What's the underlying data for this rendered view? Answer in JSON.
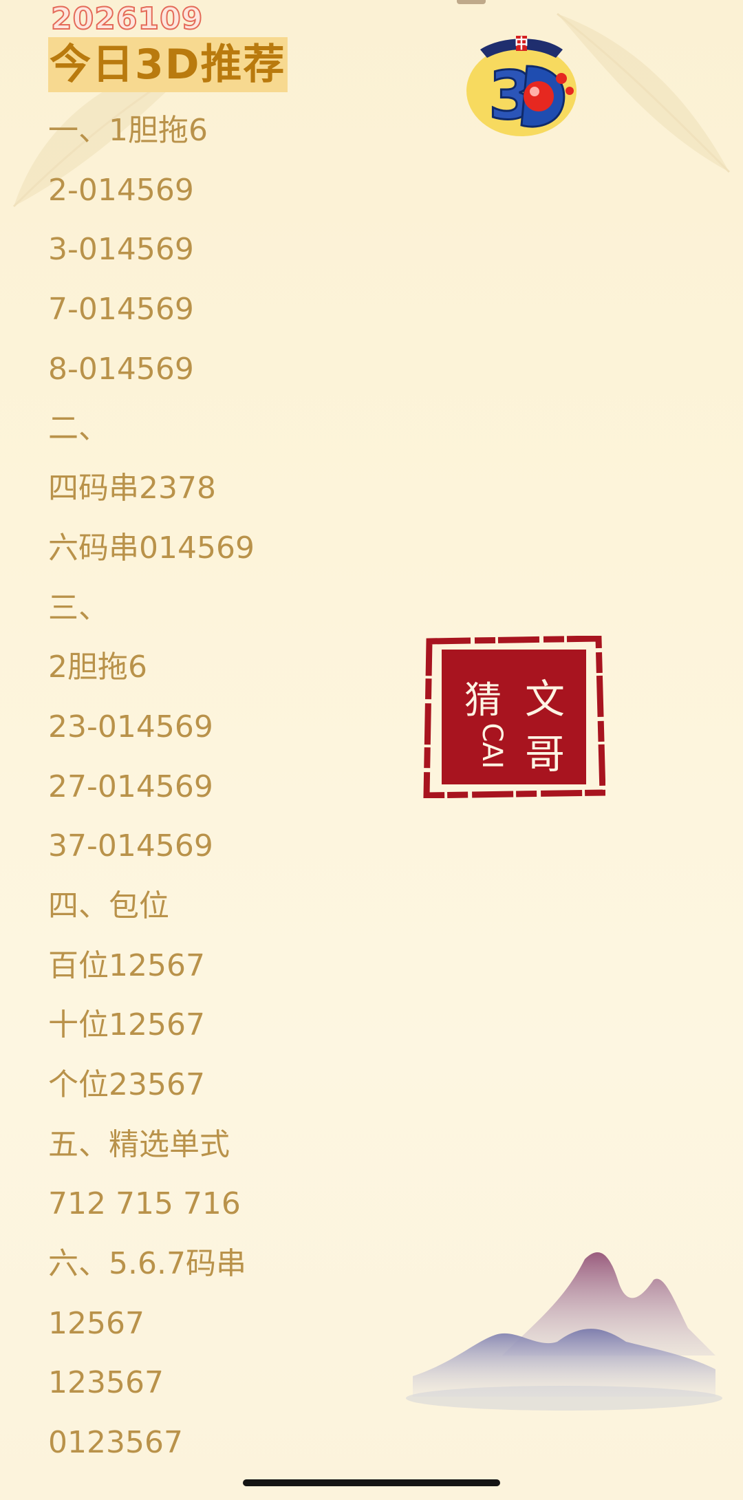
{
  "header": {
    "date": "2026109",
    "title": "今日3D推荐"
  },
  "lines": [
    "一、1胆拖6",
    "2-014569",
    "3-014569",
    "7-014569",
    "8-014569",
    "二、",
    "四码串2378",
    "六码串014569",
    "三、",
    "2胆拖6",
    "23-014569",
    "27-014569",
    "37-014569",
    "四、包位",
    "百位12567",
    "十位12567",
    "个位23567",
    "五、精选单式",
    "712 715 716",
    "六、5.6.7码串",
    "12567",
    "123567",
    "0123567"
  ],
  "logo": {
    "icon": "lottery-3d-logo-icon",
    "text": "中3D"
  },
  "seal": {
    "icon": "seal-stamp-icon",
    "chars": [
      "文",
      "哥",
      "猜",
      "CAI"
    ]
  },
  "colors": {
    "text": "#b9924a",
    "title": "#b97a0e",
    "title_bg": "#f7d990",
    "date_stroke": "#e46a58",
    "seal": "#a8141f"
  }
}
